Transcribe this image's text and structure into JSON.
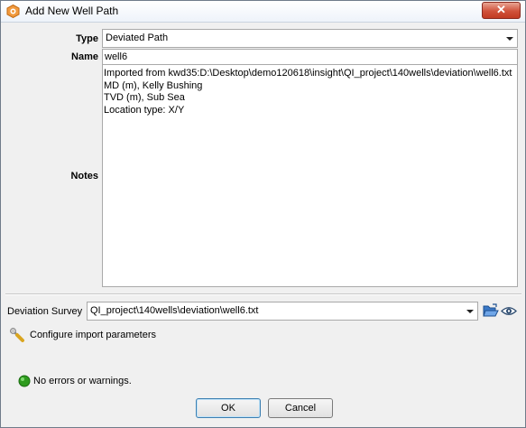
{
  "window": {
    "title": "Add New Well Path",
    "close_symbol": "✕"
  },
  "form": {
    "type_label": "Type",
    "type_value": "Deviated Path",
    "name_label": "Name",
    "name_value": "well6",
    "notes_label": "Notes",
    "notes_lines": [
      "Imported from kwd35:D:\\Desktop\\demo120618\\insight\\QI_project\\140wells\\deviation\\well6.txt",
      "MD (m), Kelly Bushing",
      "TVD (m), Sub Sea",
      "Location type: X/Y"
    ]
  },
  "deviation": {
    "label": "Deviation Survey",
    "value": "QI_project\\140wells\\deviation\\well6.txt",
    "browse_icon": "folder-open-icon",
    "view_icon": "eye-icon"
  },
  "configure": {
    "icon": "wrench-icon",
    "label": "Configure import parameters"
  },
  "status": {
    "icon": "status-ok-icon",
    "color": "#2e9b1e",
    "text": "No errors or warnings."
  },
  "buttons": {
    "ok": "OK",
    "cancel": "Cancel"
  }
}
